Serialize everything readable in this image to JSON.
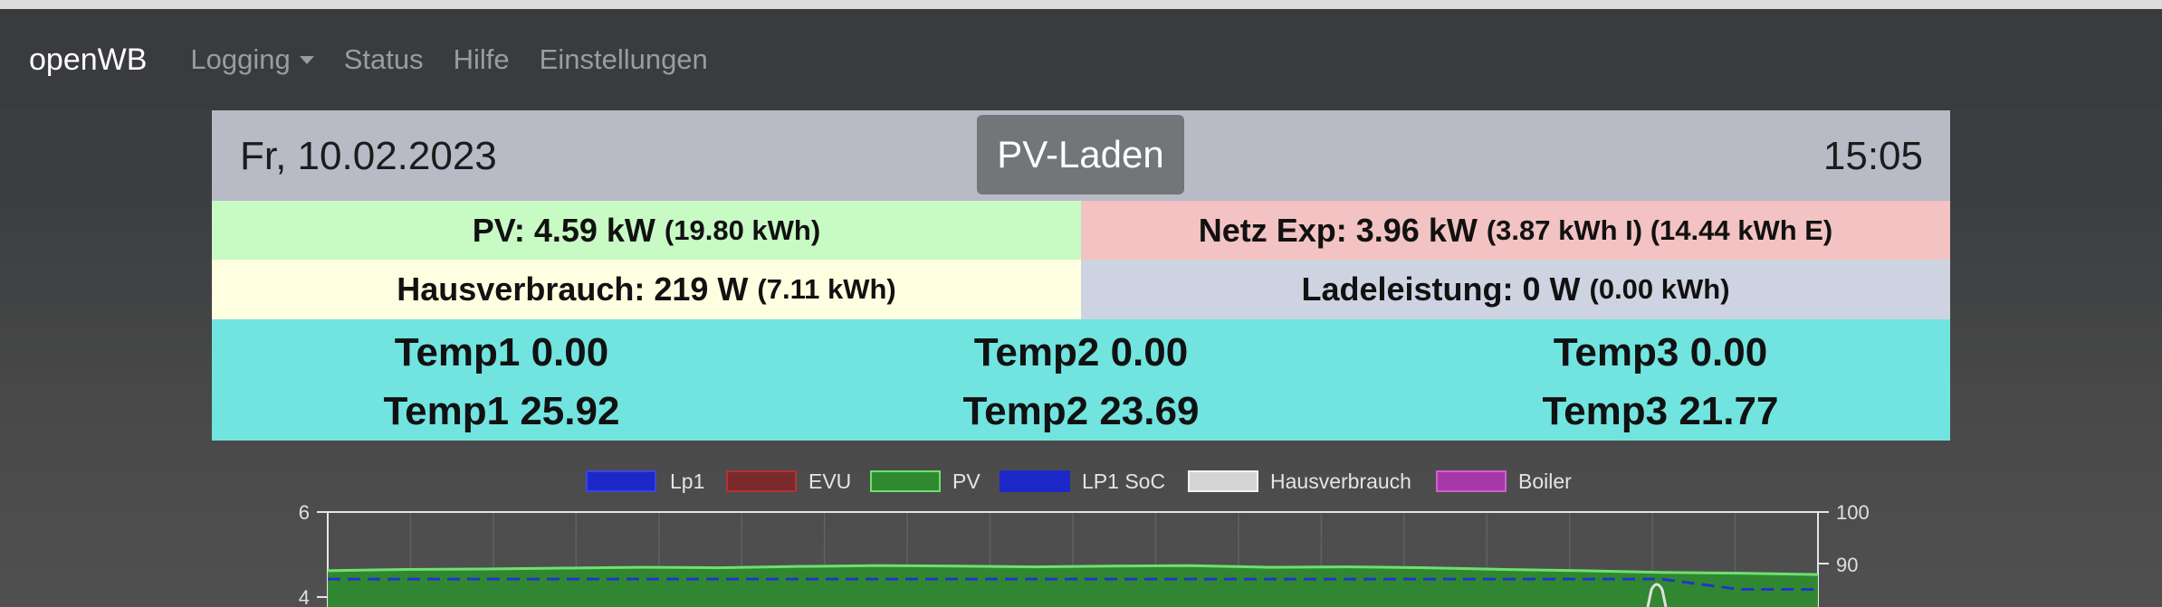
{
  "nav": {
    "brand": "openWB",
    "items": [
      {
        "label": "Logging",
        "dropdown": true
      },
      {
        "label": "Status"
      },
      {
        "label": "Hilfe"
      },
      {
        "label": "Einstellungen"
      }
    ]
  },
  "header": {
    "date": "Fr, 10.02.2023",
    "mode": "PV-Laden",
    "time": "15:05"
  },
  "stats": {
    "pv": {
      "main": "PV: 4.59 kW",
      "detail": "(19.80 kWh)"
    },
    "netz": {
      "main": "Netz Exp: 3.96 kW",
      "detail": "(3.87 kWh I) (14.44 kWh E)"
    },
    "haus": {
      "main": "Hausverbrauch: 219 W",
      "detail": "(7.11 kWh)"
    },
    "lade": {
      "main": "Ladeleistung: 0 W",
      "detail": "(0.00 kWh)"
    }
  },
  "temps": {
    "row1": [
      "Temp1 0.00",
      "Temp2 0.00",
      "Temp3 0.00"
    ],
    "row2": [
      "Temp1 25.92",
      "Temp2 23.69",
      "Temp3 21.77"
    ]
  },
  "colors": {
    "pv_bg": "#c8fac4",
    "netz_bg": "#f3c2c2",
    "haus_bg": "#fefee0",
    "lade_bg": "#cdd3e0",
    "temp_bg": "#71e4e0"
  },
  "chart_data": {
    "type": "area",
    "legend": [
      {
        "name": "Lp1",
        "color": "#1c28c8"
      },
      {
        "name": "EVU",
        "color": "#b43232"
      },
      {
        "name": "PV",
        "color": "#3fb43f"
      },
      {
        "name": "LP1 SoC",
        "color": "#1c28c8"
      },
      {
        "name": "Hausverbrauch",
        "color": "#d4d4d4"
      },
      {
        "name": "Boiler",
        "color": "#b040b0"
      }
    ],
    "y_left_ticks": [
      "6",
      "4"
    ],
    "y_right_ticks": [
      "100",
      "90"
    ],
    "ylim_left": [
      0,
      6
    ],
    "ylim_right": [
      0,
      100
    ],
    "series": [
      {
        "name": "PV",
        "values": [
          4.62,
          4.65,
          4.66,
          4.68,
          4.7,
          4.69,
          4.72,
          4.74,
          4.73,
          4.71,
          4.73,
          4.74,
          4.7,
          4.71,
          4.69,
          4.65,
          4.62,
          4.58,
          4.56,
          4.53
        ]
      },
      {
        "name": "LP1 SoC",
        "values": [
          87,
          87,
          87,
          87,
          87,
          87,
          87,
          87,
          87,
          87,
          87,
          87,
          87,
          87,
          87,
          87,
          87,
          87,
          85,
          85
        ]
      }
    ]
  }
}
